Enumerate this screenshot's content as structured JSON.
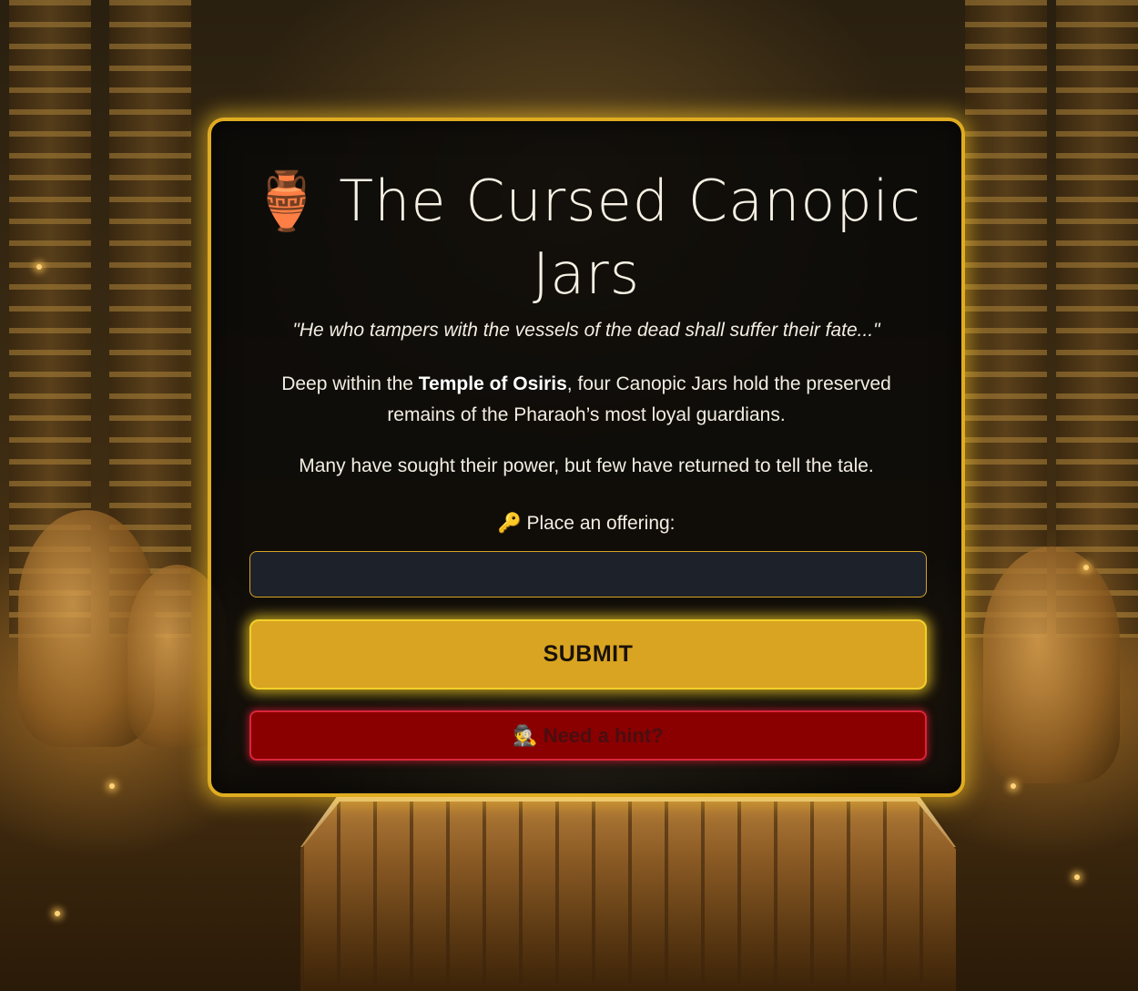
{
  "page": {
    "title_icon": "amphora-icon",
    "title_icon_glyph": "🏺",
    "title": "The Cursed Canopic Jars",
    "quote": "\"He who tampers with the vessels of the dead shall suffer their fate...\"",
    "intro_before": "Deep within the ",
    "intro_bold": "Temple of Osiris",
    "intro_after": ", four Canopic Jars hold the preserved remains of the Pharaoh’s most loyal guardians.",
    "warning": "Many have sought their power, but few have returned to tell the tale."
  },
  "form": {
    "label_icon": "key-icon",
    "label_icon_glyph": "🔑",
    "label": " Place an offering:",
    "input_value": "",
    "input_placeholder": "",
    "submit_label": "SUBMIT",
    "hint_icon": "detective-icon",
    "hint_icon_glyph": "🕵",
    "hint_label": "Need a hint?"
  },
  "colors": {
    "panel_border": "#e0ac20",
    "submit_bg": "#d9a421",
    "hint_bg": "#8a0000",
    "hint_border": "#d8253a",
    "input_bg": "#1d2129"
  }
}
